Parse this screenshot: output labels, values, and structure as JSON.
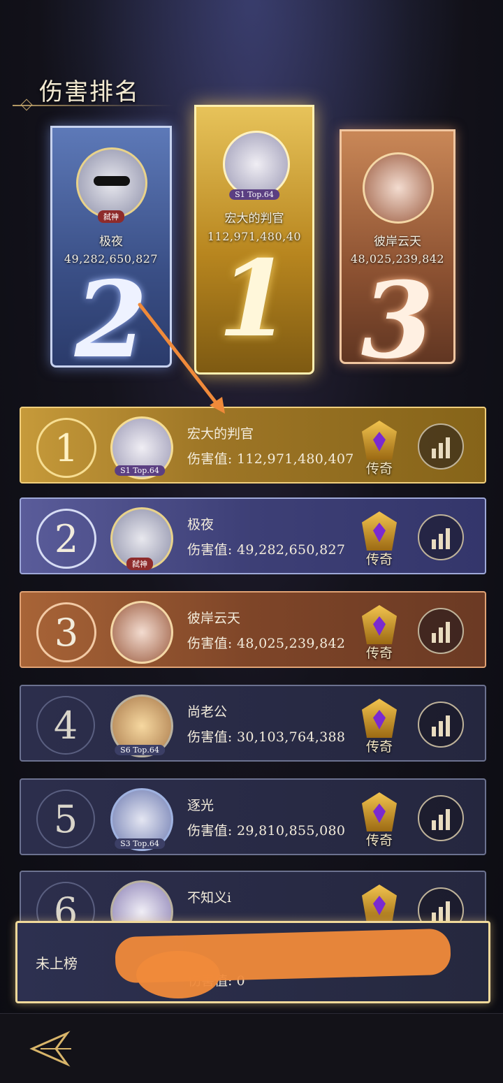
{
  "header": {
    "title": "伤害排名"
  },
  "podium": [
    {
      "rank": "2",
      "name": "极夜",
      "score": "49,282,650,827",
      "tag": "弑神"
    },
    {
      "rank": "1",
      "name": "宏大的判官",
      "score": "112,971,480,40",
      "tag": "S1 Top.64"
    },
    {
      "rank": "3",
      "name": "彼岸云天",
      "score": "48,025,239,842"
    }
  ],
  "list": {
    "damage_label": "伤害值:",
    "legend_label": "传奇",
    "rows": [
      {
        "rank": "1",
        "name": "宏大的判官",
        "damage": "112,971,480,407",
        "tag": "S1 Top.64"
      },
      {
        "rank": "2",
        "name": "极夜",
        "damage": "49,282,650,827",
        "tag": "弑神"
      },
      {
        "rank": "3",
        "name": "彼岸云天",
        "damage": "48,025,239,842"
      },
      {
        "rank": "4",
        "name": "尚老公",
        "damage": "30,103,764,388",
        "tag": "S6 Top.64"
      },
      {
        "rank": "5",
        "name": "逐光",
        "damage": "29,810,855,080",
        "tag": "S3 Top.64"
      },
      {
        "rank": "6",
        "name": "不知义i"
      }
    ]
  },
  "me": {
    "rank_label": "未上榜",
    "damage_label": "伤害值:",
    "damage": "0"
  },
  "colors": {
    "gold": "#f1cf7c",
    "silver": "#9ea8d8",
    "bronze": "#e0a274",
    "annotation": "#f08a3a"
  },
  "icons": {
    "stats": "bar-chart-icon",
    "legend": "legend-emblem-icon",
    "back": "back-arrow-icon"
  }
}
